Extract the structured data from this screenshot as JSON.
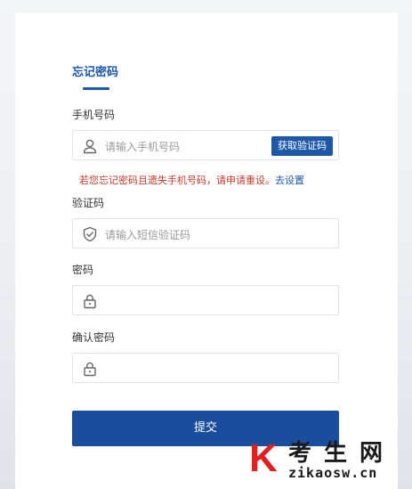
{
  "form": {
    "title": "忘记密码",
    "phone_label": "手机号码",
    "phone_placeholder": "请输入手机号码",
    "sms_button": "获取验证码",
    "warning_text": "若您忘记密码且遗失手机号码，请申请重设。",
    "warning_link": "去设置",
    "code_label": "验证码",
    "code_placeholder": "请输入短信验证码",
    "password_label": "密码",
    "confirm_label": "确认密码",
    "submit_label": "提交"
  },
  "watermark": {
    "letter": "K",
    "chinese": "考生网",
    "url": "zikaosw.cn"
  },
  "colors": {
    "brand": "#1e58a8",
    "warning": "#c0392b",
    "watermark_red": "#e02020"
  },
  "icons": {
    "phone_field": "user-icon",
    "code_field": "shield-check-icon",
    "password_field": "lock-icon",
    "confirm_field": "lock-icon"
  }
}
